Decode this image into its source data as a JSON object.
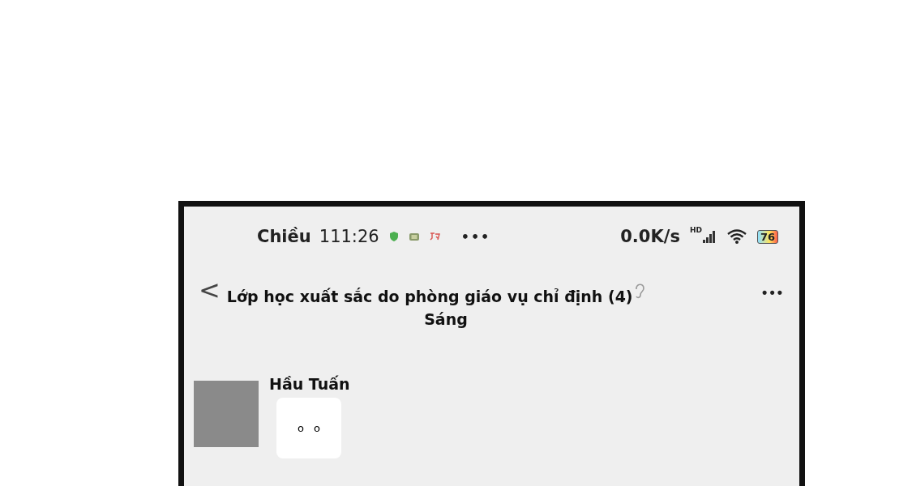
{
  "status_bar": {
    "period": "Chiều",
    "time": "111:26",
    "more": "•••",
    "speed": "0.0K/s",
    "network": "HD",
    "battery": "76"
  },
  "header": {
    "title": "Lớp học xuất sắc do phòng giáo vụ chỉ định (4)",
    "subtitle": "Sáng",
    "back": "<",
    "more": "•••"
  },
  "messages": [
    {
      "sender": "Hầu Tuấn",
      "text": "o o"
    }
  ]
}
